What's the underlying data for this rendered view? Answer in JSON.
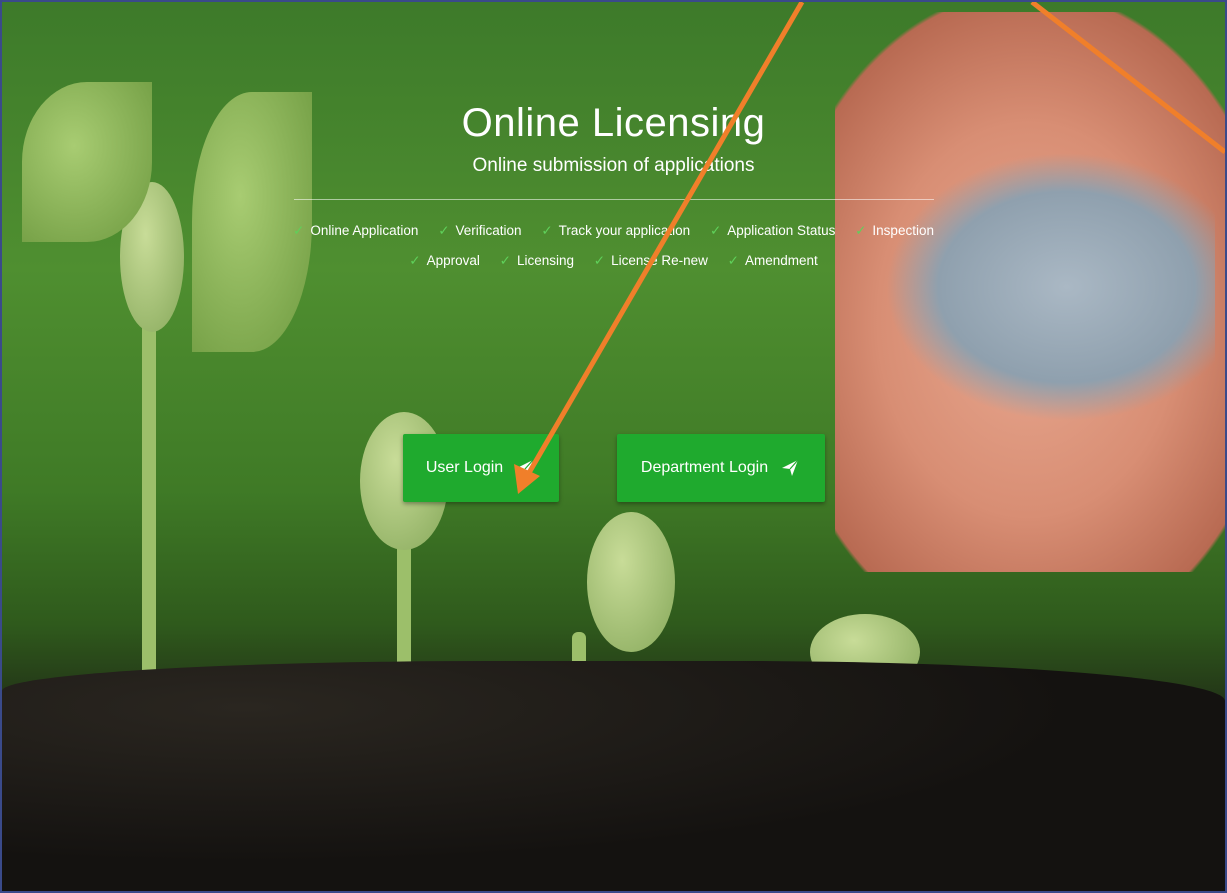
{
  "hero": {
    "title": "Online Licensing",
    "subtitle": "Online submission of applications"
  },
  "features": [
    "Online Application",
    "Verification",
    "Track your application",
    "Application Status",
    "Inspection",
    "Approval",
    "Licensing",
    "License Re-new",
    "Amendment"
  ],
  "buttons": {
    "user_login": "User Login",
    "department_login": "Department Login"
  },
  "colors": {
    "button_green": "#1faa2e",
    "check_green": "#5fd05a",
    "annotation_arrow": "#f07f2a"
  },
  "icons": {
    "button_icon": "paper-plane-icon",
    "feature_icon": "checkmark-icon"
  }
}
